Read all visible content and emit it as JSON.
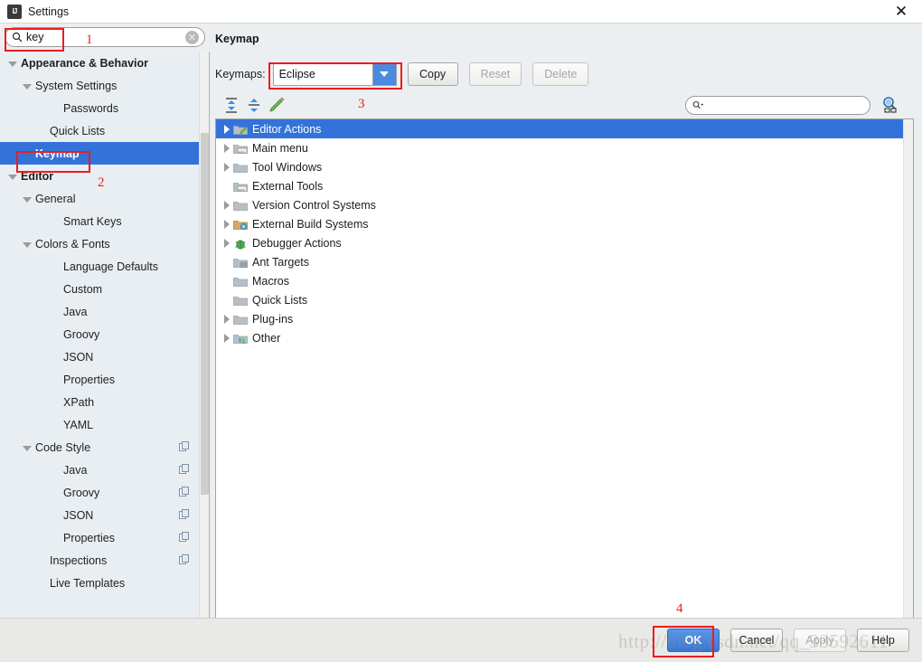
{
  "window": {
    "title": "Settings",
    "app_icon": "intellij-idea-icon",
    "close_label": "✕"
  },
  "sidebar": {
    "search": {
      "value": "key",
      "placeholder": "",
      "icon": "search-icon",
      "clear_icon": "clear-icon"
    },
    "items": [
      {
        "label": "Appearance & Behavior",
        "indent": 8,
        "arrow": "open",
        "bold": true,
        "selected": false,
        "badge": false
      },
      {
        "label": "System Settings",
        "indent": 24,
        "arrow": "open",
        "bold": false,
        "selected": false,
        "badge": false
      },
      {
        "label": "Passwords",
        "indent": 55,
        "arrow": "none",
        "bold": false,
        "selected": false,
        "badge": false
      },
      {
        "label": "Quick Lists",
        "indent": 40,
        "arrow": "none",
        "bold": false,
        "selected": false,
        "badge": false
      },
      {
        "label": "Keymap",
        "indent": 24,
        "arrow": "none",
        "bold": true,
        "selected": true,
        "badge": false
      },
      {
        "label": "Editor",
        "indent": 8,
        "arrow": "open",
        "bold": true,
        "selected": false,
        "badge": false
      },
      {
        "label": "General",
        "indent": 24,
        "arrow": "open",
        "bold": false,
        "selected": false,
        "badge": false
      },
      {
        "label": "Smart Keys",
        "indent": 55,
        "arrow": "none",
        "bold": false,
        "selected": false,
        "badge": false
      },
      {
        "label": "Colors & Fonts",
        "indent": 24,
        "arrow": "open",
        "bold": false,
        "selected": false,
        "badge": false
      },
      {
        "label": "Language Defaults",
        "indent": 55,
        "arrow": "none",
        "bold": false,
        "selected": false,
        "badge": false
      },
      {
        "label": "Custom",
        "indent": 55,
        "arrow": "none",
        "bold": false,
        "selected": false,
        "badge": false
      },
      {
        "label": "Java",
        "indent": 55,
        "arrow": "none",
        "bold": false,
        "selected": false,
        "badge": false
      },
      {
        "label": "Groovy",
        "indent": 55,
        "arrow": "none",
        "bold": false,
        "selected": false,
        "badge": false
      },
      {
        "label": "JSON",
        "indent": 55,
        "arrow": "none",
        "bold": false,
        "selected": false,
        "badge": false
      },
      {
        "label": "Properties",
        "indent": 55,
        "arrow": "none",
        "bold": false,
        "selected": false,
        "badge": false
      },
      {
        "label": "XPath",
        "indent": 55,
        "arrow": "none",
        "bold": false,
        "selected": false,
        "badge": false
      },
      {
        "label": "YAML",
        "indent": 55,
        "arrow": "none",
        "bold": false,
        "selected": false,
        "badge": false
      },
      {
        "label": "Code Style",
        "indent": 24,
        "arrow": "open",
        "bold": false,
        "selected": false,
        "badge": true
      },
      {
        "label": "Java",
        "indent": 55,
        "arrow": "none",
        "bold": false,
        "selected": false,
        "badge": true
      },
      {
        "label": "Groovy",
        "indent": 55,
        "arrow": "none",
        "bold": false,
        "selected": false,
        "badge": true
      },
      {
        "label": "JSON",
        "indent": 55,
        "arrow": "none",
        "bold": false,
        "selected": false,
        "badge": true
      },
      {
        "label": "Properties",
        "indent": 55,
        "arrow": "none",
        "bold": false,
        "selected": false,
        "badge": true
      },
      {
        "label": "Inspections",
        "indent": 40,
        "arrow": "none",
        "bold": false,
        "selected": false,
        "badge": true
      },
      {
        "label": "Live Templates",
        "indent": 40,
        "arrow": "none",
        "bold": false,
        "selected": false,
        "badge": false
      }
    ]
  },
  "main": {
    "title": "Keymap",
    "keymaps_label": "Keymaps:",
    "keymap_selected": "Eclipse",
    "keymap_options": [
      "Eclipse"
    ],
    "buttons": [
      {
        "label": "Copy",
        "enabled": true
      },
      {
        "label": "Reset",
        "enabled": false
      },
      {
        "label": "Delete",
        "enabled": false
      }
    ],
    "toolbar_icons": [
      "expand-all-icon",
      "collapse-all-icon",
      "edit-shortcut-icon"
    ],
    "find_field": {
      "value": "",
      "placeholder": "",
      "icon": "search-dropdown-icon"
    },
    "find_by_shortcut_icon": "find-by-shortcut-icon",
    "tree": [
      {
        "label": "Editor Actions",
        "arrow": "closed",
        "icon": "folder-editor-icon",
        "selected": true
      },
      {
        "label": "Main menu",
        "arrow": "closed",
        "icon": "folder-menu-icon",
        "selected": false
      },
      {
        "label": "Tool Windows",
        "arrow": "closed",
        "icon": "folder-icon",
        "selected": false
      },
      {
        "label": "External Tools",
        "arrow": "none",
        "icon": "folder-tools-icon",
        "selected": false
      },
      {
        "label": "Version Control Systems",
        "arrow": "closed",
        "icon": "folder-icon",
        "selected": false
      },
      {
        "label": "External Build Systems",
        "arrow": "closed",
        "icon": "folder-build-icon",
        "selected": false
      },
      {
        "label": "Debugger Actions",
        "arrow": "closed",
        "icon": "bug-icon",
        "selected": false
      },
      {
        "label": "Ant Targets",
        "arrow": "none",
        "icon": "folder-ant-icon",
        "selected": false
      },
      {
        "label": "Macros",
        "arrow": "none",
        "icon": "folder-icon",
        "selected": false
      },
      {
        "label": "Quick Lists",
        "arrow": "none",
        "icon": "folder-icon",
        "selected": false
      },
      {
        "label": "Plug-ins",
        "arrow": "closed",
        "icon": "folder-icon",
        "selected": false
      },
      {
        "label": "Other",
        "arrow": "closed",
        "icon": "folder-other-icon",
        "selected": false
      }
    ]
  },
  "footer": {
    "buttons": [
      {
        "label": "OK",
        "style": "primary",
        "enabled": true
      },
      {
        "label": "Cancel",
        "style": "normal",
        "enabled": true
      },
      {
        "label": "Apply",
        "style": "normal",
        "enabled": false
      },
      {
        "label": "Help",
        "style": "normal",
        "enabled": true
      }
    ]
  },
  "annotations": {
    "n1": "1",
    "n2": "2",
    "n3": "3",
    "n4": "4",
    "color": "#ee1c1c"
  },
  "watermark": "http://blog.csdn.net/qq_33592611"
}
